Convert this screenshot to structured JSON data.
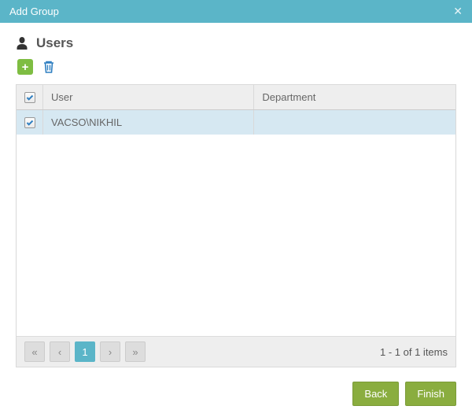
{
  "dialog": {
    "title": "Add Group"
  },
  "section": {
    "title": "Users"
  },
  "columns": {
    "checkbox": "",
    "user": "User",
    "department": "Department"
  },
  "rows": [
    {
      "user": "VACSO\\NIKHIL",
      "department": "",
      "selected": true
    }
  ],
  "pager": {
    "current": "1",
    "status": "1 - 1 of 1 items"
  },
  "buttons": {
    "back": "Back",
    "finish": "Finish"
  }
}
